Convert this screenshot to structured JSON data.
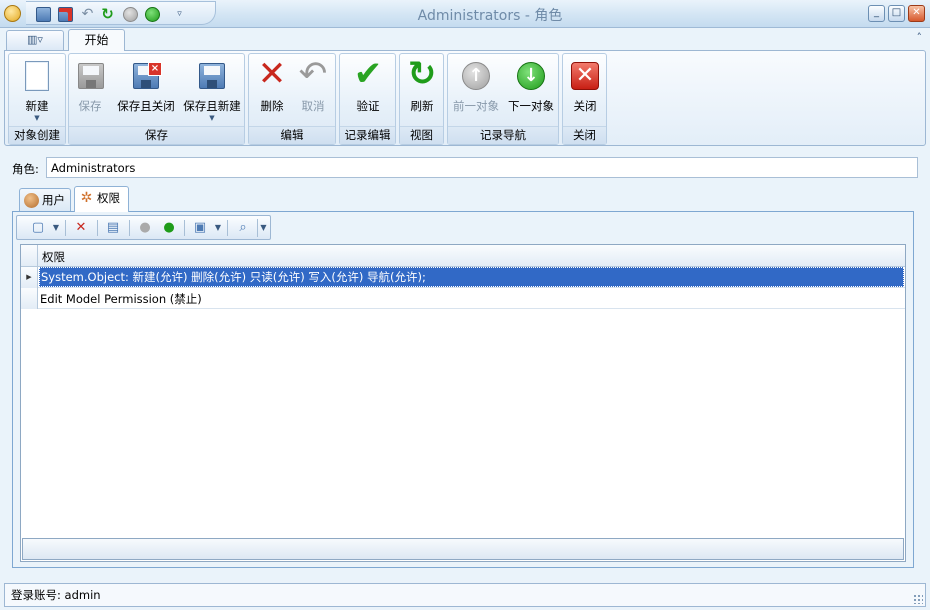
{
  "window": {
    "title": "Administrators - 角色",
    "buttons": {
      "minimize": "_",
      "maximize": "□",
      "close": "✕"
    }
  },
  "ribbon": {
    "tabs": {
      "file": "▥▿",
      "start": "开始"
    },
    "collapse": "˄",
    "groups": {
      "create": {
        "label": "对象创建",
        "new": "新建"
      },
      "save": {
        "label": "保存",
        "save": "保存",
        "save_close": "保存且关闭",
        "save_new": "保存且新建"
      },
      "edit": {
        "label": "编辑",
        "delete": "删除",
        "cancel": "取消"
      },
      "record_edit": {
        "label": "记录编辑",
        "validate": "验证"
      },
      "view": {
        "label": "视图",
        "refresh": "刷新"
      },
      "nav": {
        "label": "记录导航",
        "prev": "前一对象",
        "next": "下一对象"
      },
      "close": {
        "label": "关闭",
        "close": "关闭"
      }
    }
  },
  "detail": {
    "role_label": "角色:",
    "role_value": "Administrators",
    "tabs": {
      "users": "用户",
      "permissions": "权限"
    }
  },
  "grid": {
    "column": "权限",
    "rows": [
      "System.Object: 新建(允许) 删除(允许) 只读(允许) 写入(允许) 导航(允许);",
      "Edit Model Permission (禁止)"
    ],
    "row_indicator": "▶"
  },
  "status": {
    "text": "登录账号: admin"
  },
  "colors": {
    "accent": "#3169c6",
    "chrome": "#d3e5f4",
    "border": "#9db7d3"
  }
}
